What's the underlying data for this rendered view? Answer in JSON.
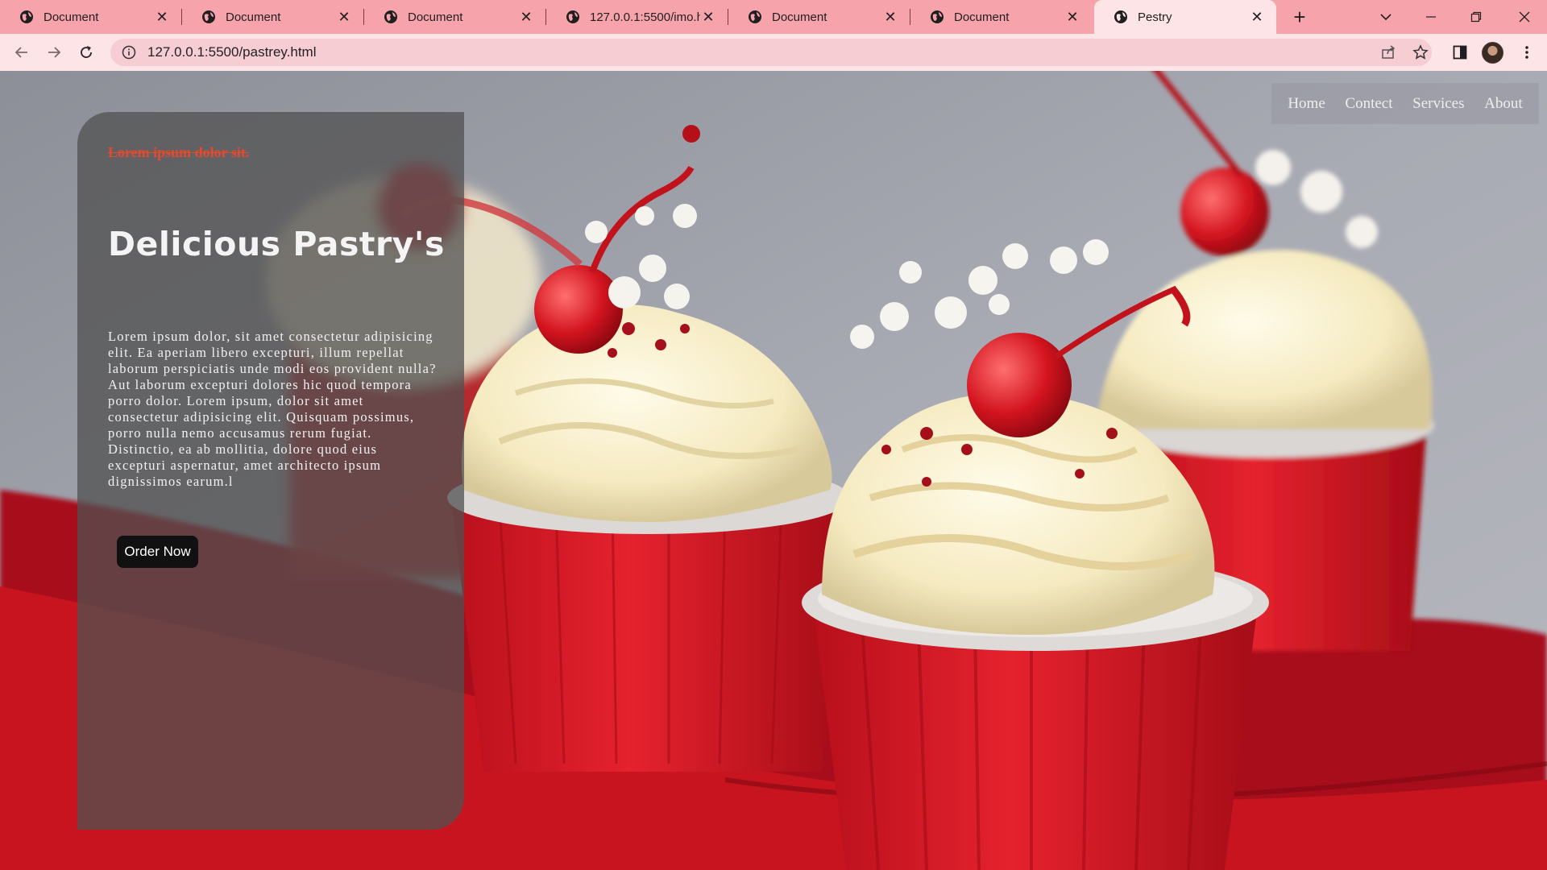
{
  "browser": {
    "tabs": [
      {
        "title": "Document"
      },
      {
        "title": "Document"
      },
      {
        "title": "Document"
      },
      {
        "title": "127.0.0.1:5500/imo.ht"
      },
      {
        "title": "Document"
      },
      {
        "title": "Document"
      },
      {
        "title": "Pestry",
        "active": true
      }
    ],
    "url": "127.0.0.1:5500/pastrey.html"
  },
  "page": {
    "nav": [
      "Home",
      "Contect",
      "Services",
      "About"
    ],
    "kicker": "Lorem ipsum dolor sit.",
    "headline": "Delicious Pastry's",
    "body": "Lorem ipsum dolor, sit amet consectetur adipisicing elit. Ea aperiam libero excepturi, illum repellat laborum perspiciatis unde modi eos provident nulla? Aut laborum excepturi dolores hic quod tempora porro dolor. Lorem ipsum, dolor sit amet consectetur adipisicing elit. Quisquam possimus, porro nulla nemo accusamus rerum fugiat. Distinctio, ea ab mollitia, dolore quod eius excepturi aspernatur, amet architecto ipsum dignissimos earum.l",
    "button": "Order Now"
  },
  "colors": {
    "tabbar": "#f7a3ac",
    "toolbar": "#fde4e7",
    "accent_red": "#d8232f",
    "kicker": "#e64a2e"
  },
  "icons": [
    "globe-icon",
    "close-icon",
    "plus-icon",
    "chevron-down-icon",
    "minimize-icon",
    "restore-icon",
    "back-icon",
    "forward-icon",
    "reload-icon",
    "info-icon",
    "share-icon",
    "star-icon",
    "sidepanel-icon",
    "kebab-menu-icon"
  ]
}
